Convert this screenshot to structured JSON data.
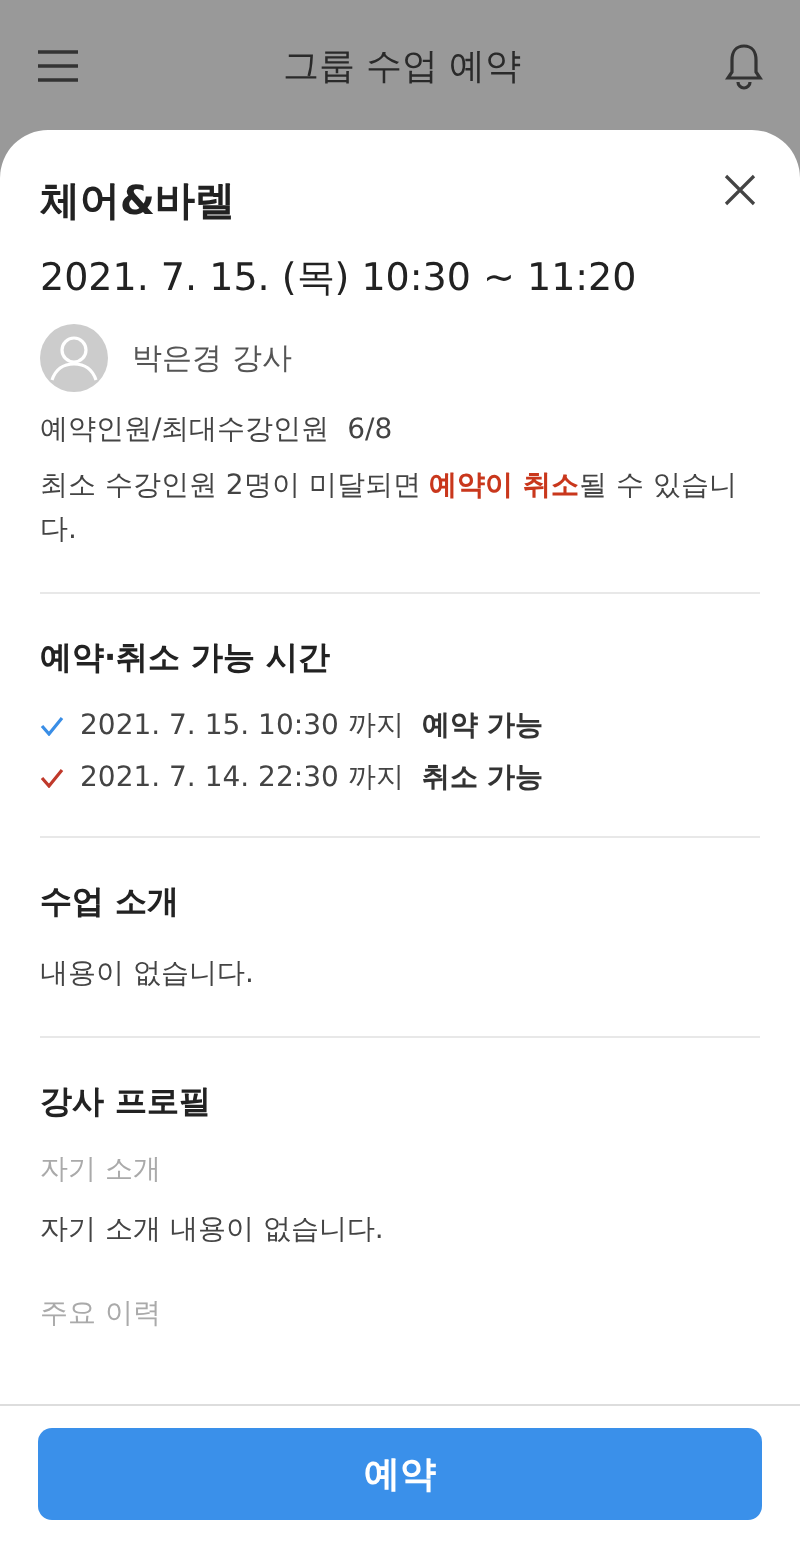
{
  "header": {
    "title": "그룹 수업 예약"
  },
  "class": {
    "name": "체어&바렐",
    "datetime": "2021. 7. 15. (목) 10:30 ~ 11:20",
    "instructor": "박은경 강사",
    "capacity": "예약인원/최대수강인원  6/8",
    "notice": "최소 수강인원 2명이 미달되면 **예약이 취소**될 수 있습니다."
  },
  "availability": {
    "title": "예약·취소 가능 시간",
    "items": [
      {
        "text": "2021. 7. 15. 10:30 까지  **예약 가능**",
        "color": "#3a8ee6"
      },
      {
        "text": "2021. 7. 14. 22:30 까지  **취소 가능**",
        "color": "#c0392b"
      }
    ]
  },
  "intro": {
    "title": "수업 소개",
    "body": "내용이 없습니다."
  },
  "profile": {
    "title": "강사 프로필",
    "sections": [
      {
        "label": "자기 소개",
        "body": "자기 소개 내용이 없습니다."
      },
      {
        "label": "주요 이력"
      }
    ]
  },
  "footer": {
    "button": "예약"
  }
}
